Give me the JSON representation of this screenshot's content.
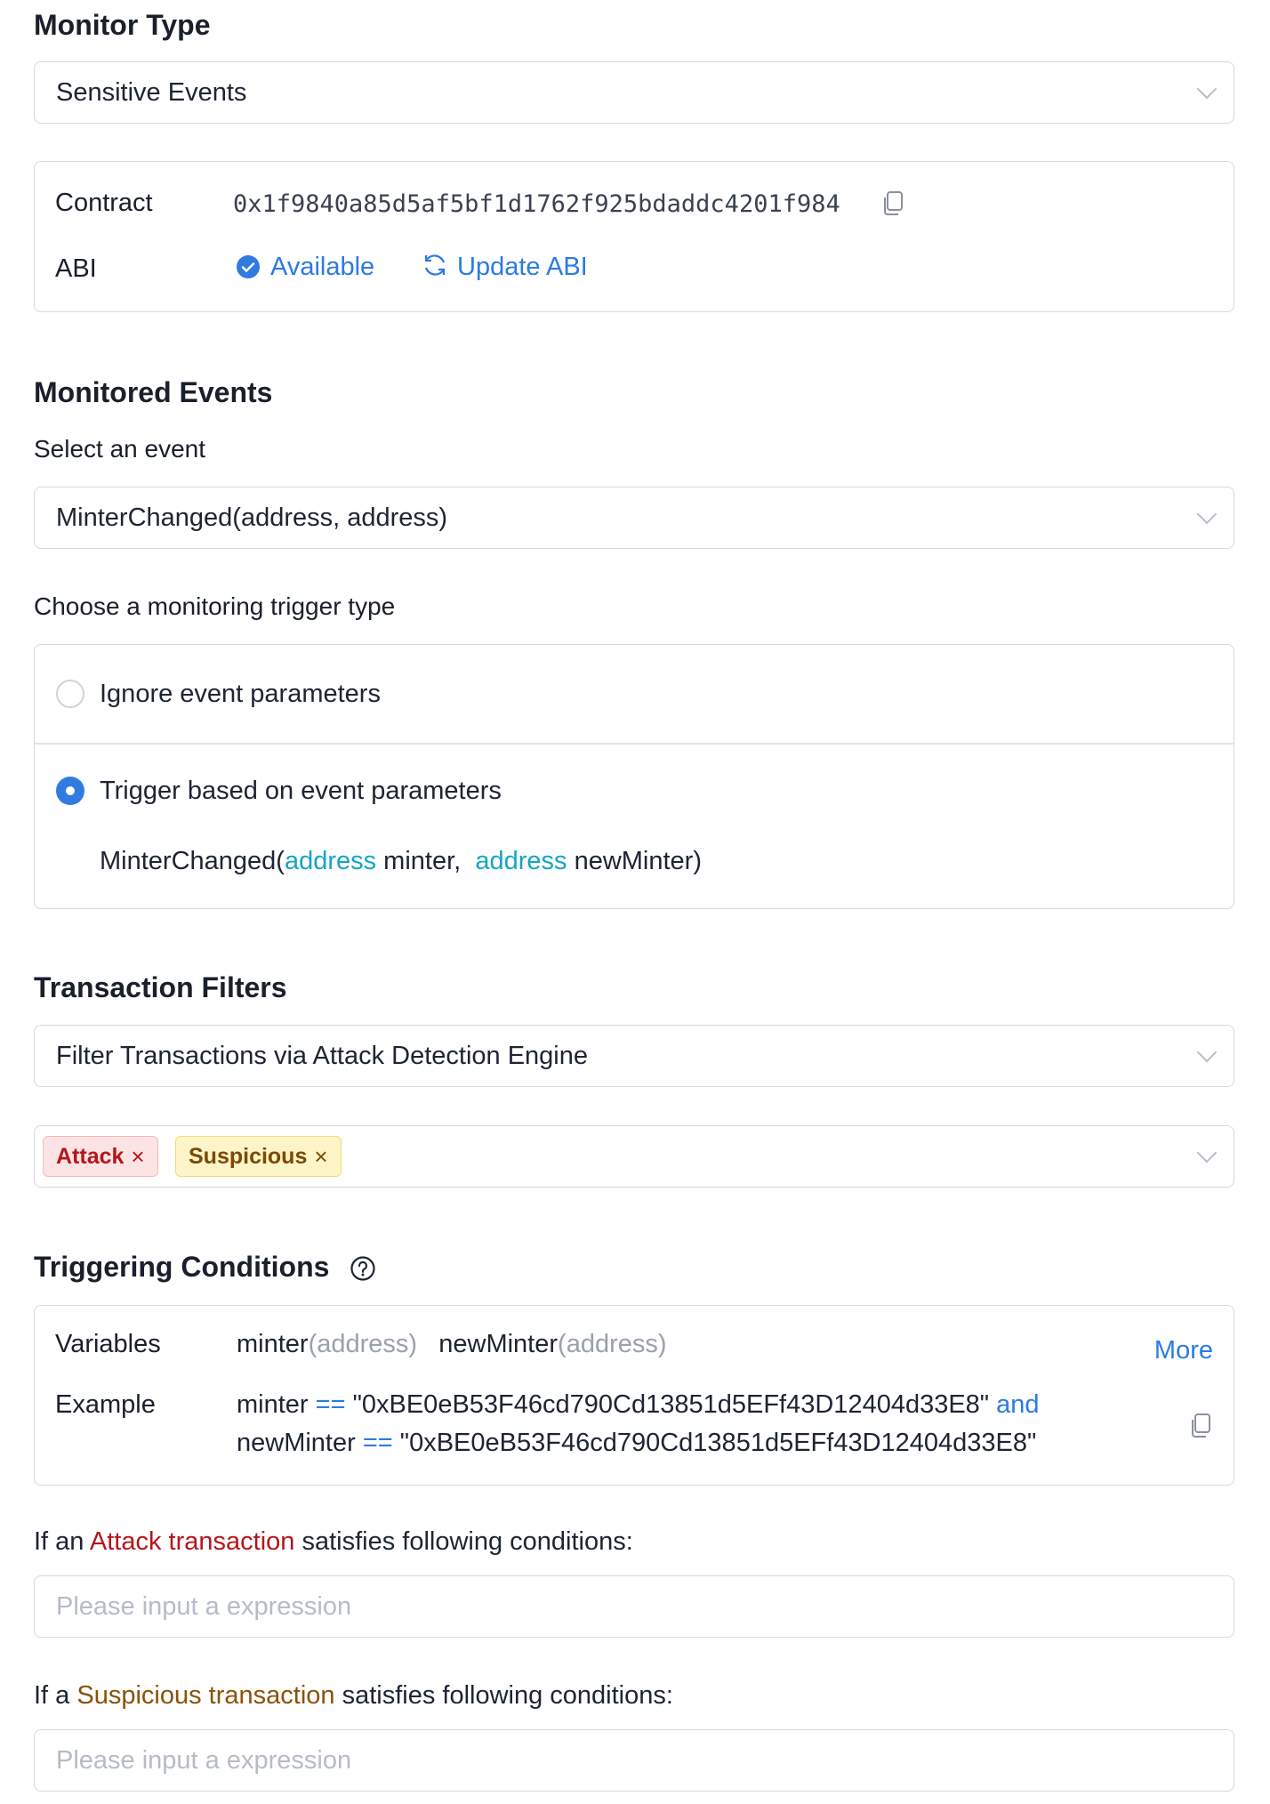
{
  "monitor_type": {
    "heading": "Monitor Type",
    "selected": "Sensitive Events"
  },
  "contract_card": {
    "contract_label": "Contract",
    "contract_address": "0x1f9840a85d5af5bf1d1762f925bdaddc4201f984",
    "abi_label": "ABI",
    "abi_status": "Available",
    "update_abi": "Update ABI"
  },
  "monitored_events": {
    "heading": "Monitored Events",
    "select_label": "Select an event",
    "selected_event": "MinterChanged(address, address)",
    "trigger_label": "Choose a monitoring trigger type",
    "options": [
      {
        "label": "Ignore event parameters",
        "checked": false
      },
      {
        "label": "Trigger based on event parameters",
        "checked": true
      }
    ],
    "signature": {
      "name": "MinterChanged(",
      "type1": "address",
      "param1": " minter,",
      "type2": "address",
      "param2": " newMinter)"
    }
  },
  "transaction_filters": {
    "heading": "Transaction Filters",
    "selected": "Filter Transactions via Attack Detection Engine",
    "tags": [
      {
        "label": "Attack",
        "remove": "×"
      },
      {
        "label": "Suspicious",
        "remove": "×"
      }
    ]
  },
  "triggering_conditions": {
    "heading": "Triggering Conditions",
    "help_icon": "question-circle-icon",
    "variables_label": "Variables",
    "var1": "minter",
    "var1_type": "(address)",
    "var2": "newMinter",
    "var2_type": "(address)",
    "more": "More",
    "example_label": "Example",
    "ex_line1_var": "minter",
    "ex_line1_op": "==",
    "ex_line1_val": "\"0xBE0eB53F46cd790Cd13851d5EFf43D12404d33E8\"",
    "ex_and": "and",
    "ex_line2_var": "newMinter",
    "ex_line2_op": "==",
    "ex_line2_val": "\"0xBE0eB53F46cd790Cd13851d5EFf43D12404d33E8\""
  },
  "attack_condition": {
    "prefix": "If an ",
    "highlight": "Attack transaction",
    "suffix": " satisfies following conditions:",
    "placeholder": "Please input a expression"
  },
  "suspicious_condition": {
    "prefix": "If a ",
    "highlight": "Suspicious transaction",
    "suffix": " satisfies following conditions:",
    "placeholder": "Please input a expression"
  },
  "colors": {
    "accent_blue": "#2b7be3",
    "type_teal": "#14a6c2",
    "attack_red": "#b5161b",
    "suspicious_brown": "#8a5208"
  }
}
